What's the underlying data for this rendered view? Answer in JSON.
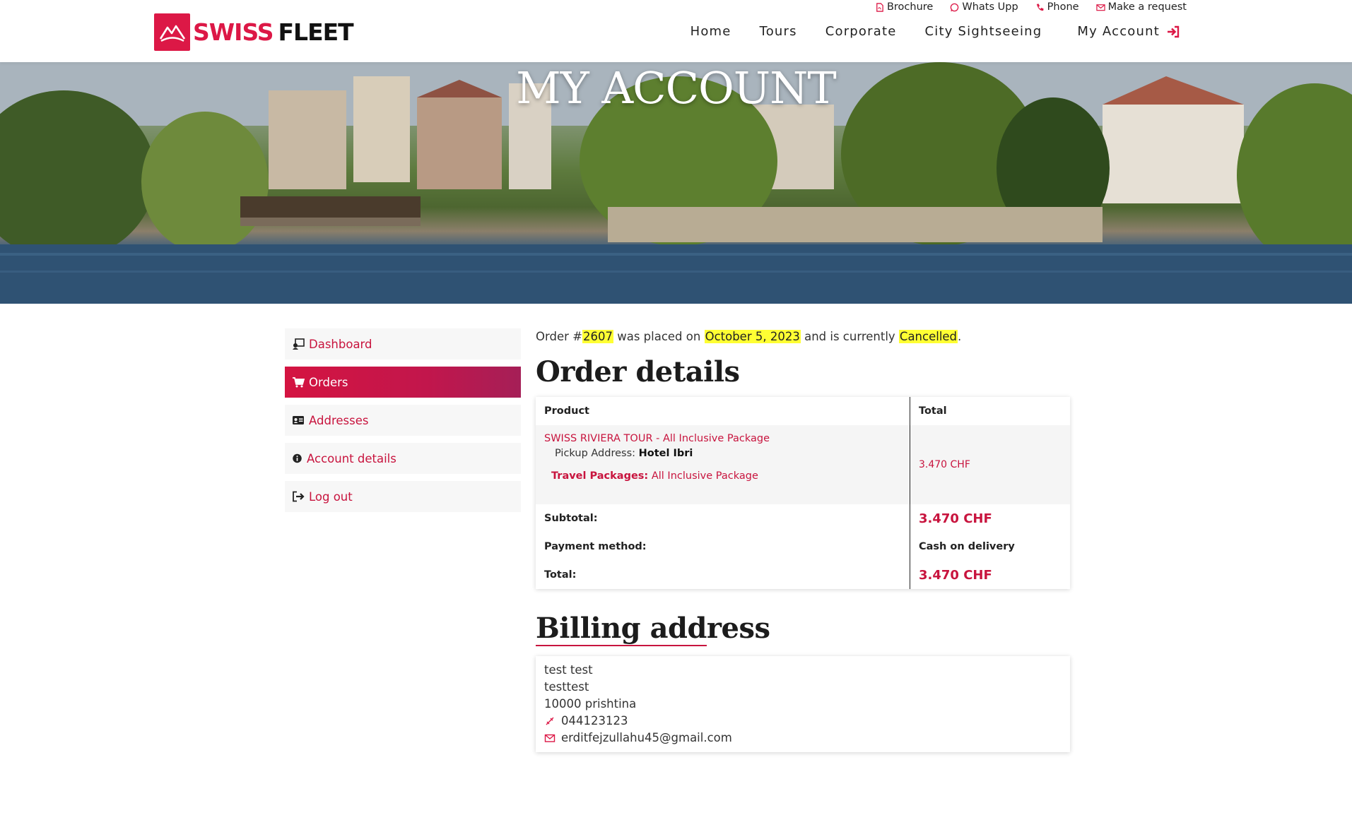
{
  "brand": {
    "name_part1": "SWISS",
    "name_part2": "FLEET"
  },
  "topbar": [
    {
      "label": "Brochure",
      "icon": "file-pdf-icon"
    },
    {
      "label": "Whats Upp",
      "icon": "whatsapp-icon"
    },
    {
      "label": "Phone",
      "icon": "phone-icon"
    },
    {
      "label": "Make a request",
      "icon": "envelope-icon"
    }
  ],
  "nav": {
    "home": "Home",
    "tours": "Tours",
    "corporate": "Corporate",
    "city": "City Sightseeing",
    "account": "My Account"
  },
  "hero": {
    "title": "MY ACCOUNT"
  },
  "sidebar": [
    {
      "label": "Dashboard",
      "icon": "dashboard-icon",
      "active": false
    },
    {
      "label": "Orders",
      "icon": "cart-icon",
      "active": true
    },
    {
      "label": "Addresses",
      "icon": "id-card-icon",
      "active": false
    },
    {
      "label": "Account details",
      "icon": "info-icon",
      "active": false
    },
    {
      "label": "Log out",
      "icon": "logout-icon",
      "active": false
    }
  ],
  "order": {
    "notice_prefix": "Order #",
    "number": "2607",
    "notice_mid1": " was placed on ",
    "date": "October 5, 2023",
    "notice_mid2": " and is currently ",
    "status": "Cancelled",
    "notice_suffix": ".",
    "details_title": "Order details",
    "col_product": "Product",
    "col_total": "Total",
    "product_name": "SWISS RIVIERA TOUR - All Inclusive Package",
    "pickup_label": "Pickup Address:",
    "pickup_value": "Hotel Ibri",
    "package_label": "Travel Packages:",
    "package_value": "All Inclusive Package",
    "product_total": "3.470 CHF",
    "subtotal_label": "Subtotal:",
    "subtotal_value": "3.470 CHF",
    "payment_label": "Payment method:",
    "payment_value": "Cash on delivery",
    "total_label": "Total:",
    "total_value": "3.470 CHF"
  },
  "billing": {
    "title": "Billing address",
    "name": "test test",
    "company": "testtest",
    "city": "10000 prishtina",
    "phone": "044123123",
    "email": "erditfejzullahu45@gmail.com"
  },
  "colors": {
    "accent": "#dc1846",
    "highlight": "#ffff33"
  }
}
